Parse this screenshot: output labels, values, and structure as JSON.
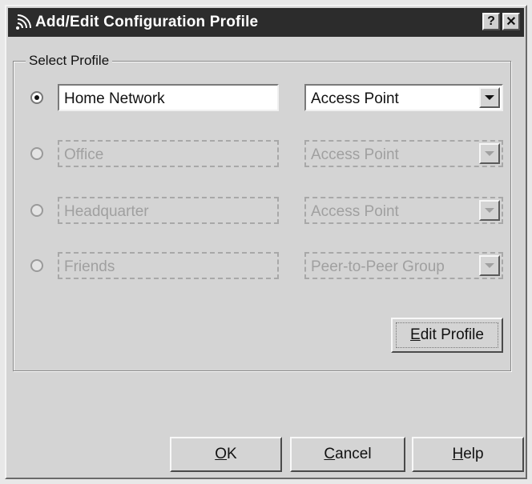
{
  "window": {
    "title": "Add/Edit Configuration Profile",
    "help_label": "?",
    "close_label": "✕"
  },
  "group": {
    "label": "Select Profile"
  },
  "profiles": [
    {
      "name": "Home Network",
      "type": "Access Point",
      "selected": true,
      "enabled": true
    },
    {
      "name": "Office",
      "type": "Access Point",
      "selected": false,
      "enabled": false
    },
    {
      "name": "Headquarter",
      "type": "Access Point",
      "selected": false,
      "enabled": false
    },
    {
      "name": "Friends",
      "type": "Peer-to-Peer Group",
      "selected": false,
      "enabled": false
    }
  ],
  "buttons": {
    "edit_profile": {
      "mnemonic": "E",
      "rest": "dit Profile"
    },
    "ok": {
      "mnemonic": "O",
      "rest": "K"
    },
    "cancel": {
      "mnemonic": "C",
      "rest": "ancel"
    },
    "help": {
      "mnemonic": "H",
      "rest": "elp"
    }
  },
  "icons": {
    "app": "wireless-signal-icon",
    "combo_arrow": "chevron-down-icon"
  }
}
